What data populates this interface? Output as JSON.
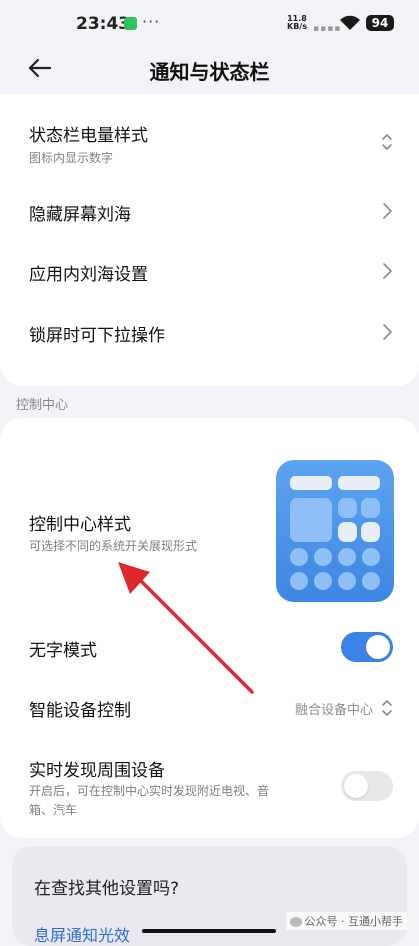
{
  "status": {
    "time": "23:43",
    "network_speed_value": "11.8",
    "network_speed_unit": "KB/s",
    "battery": "94",
    "more": "···"
  },
  "header": {
    "title": "通知与状态栏"
  },
  "settings": [
    {
      "title": "状态栏电量样式",
      "subtitle": "图标内显示数字"
    },
    {
      "title": "隐藏屏幕刘海"
    },
    {
      "title": "应用内刘海设置"
    },
    {
      "title": "锁屏时可下拉操作"
    }
  ],
  "section": {
    "label": "控制中心"
  },
  "control_center": {
    "style_title": "控制中心样式",
    "style_subtitle": "可选择不同的系统开关展现形式",
    "no_text_mode": {
      "label": "无字模式",
      "on": true
    },
    "smart_device": {
      "label": "智能设备控制",
      "value": "融合设备中心"
    },
    "realtime": {
      "label": "实时发现周围设备",
      "desc_line1": "开启后，可在控制中心实时发现附近电视、音",
      "desc_line2": "箱、汽车",
      "on": false
    }
  },
  "search_card": {
    "question": "在查找其他设置吗?",
    "link": "息屏通知光效"
  },
  "watermark": "公众号 · 互通小帮手",
  "colors": {
    "accent": "#3b82e6",
    "arrow": "#e0292f",
    "icon_blue": "#4a90e8"
  }
}
